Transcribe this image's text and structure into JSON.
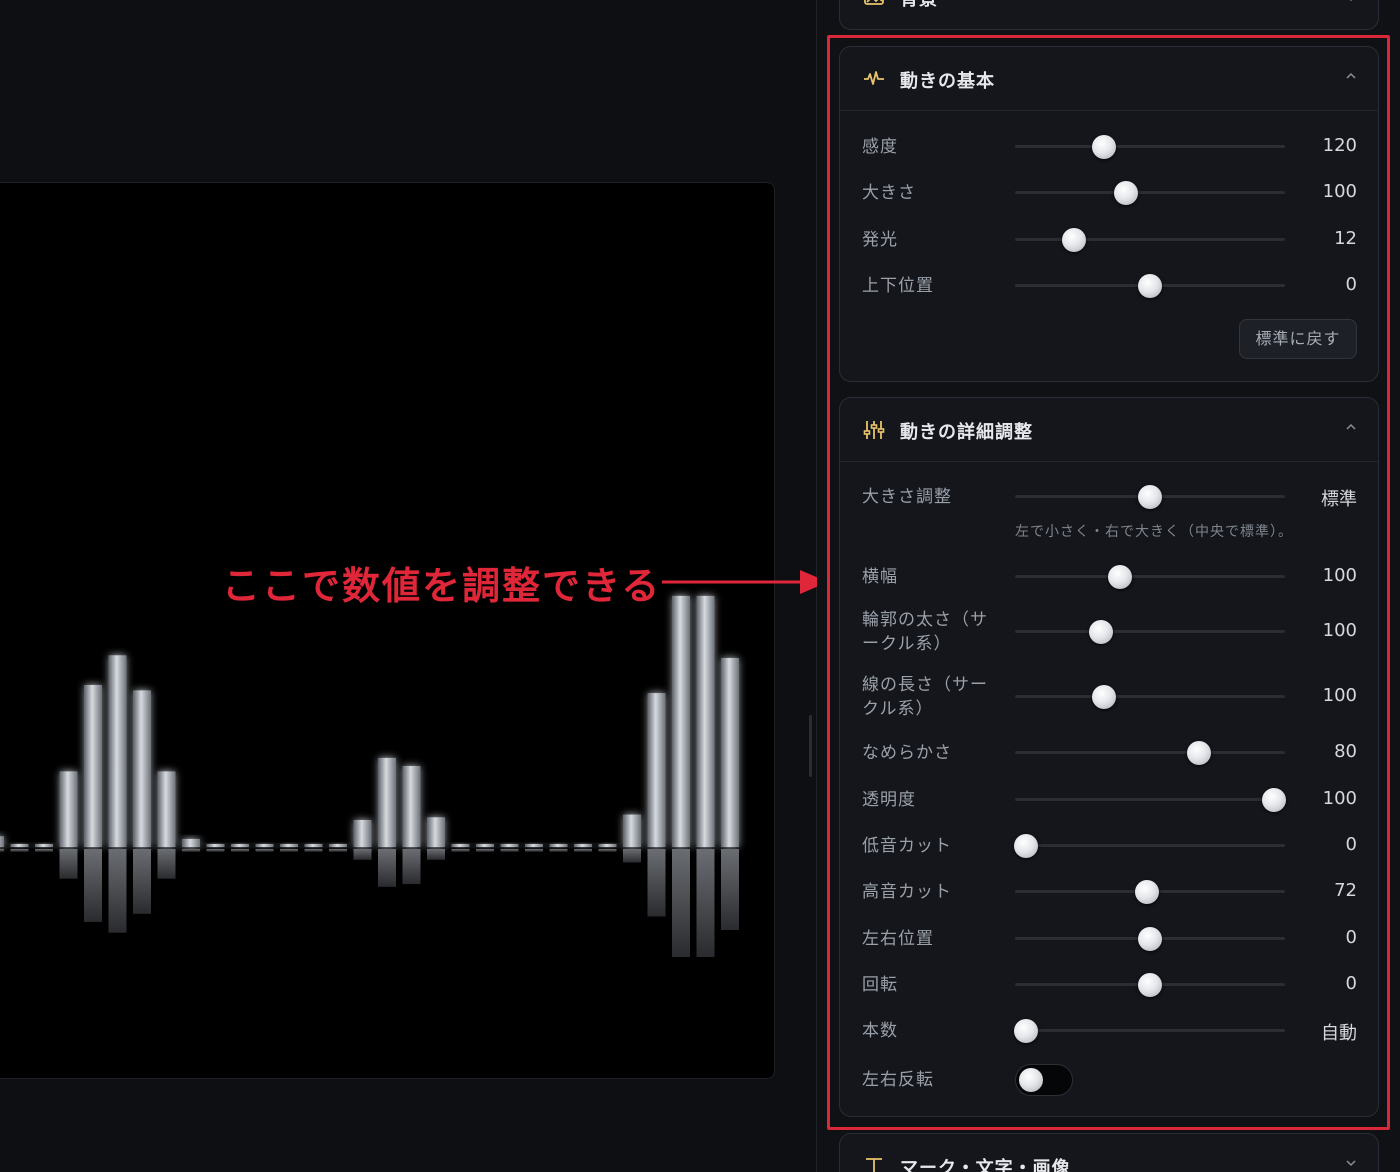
{
  "preview": {
    "bars_up": [
      0.04,
      0,
      0,
      0.28,
      0.6,
      0.71,
      0.58,
      0.28,
      0.03,
      0,
      0,
      0,
      0,
      0,
      0,
      0.1,
      0.33,
      0.3,
      0.11,
      0,
      0,
      0,
      0,
      0,
      0,
      0,
      0.12,
      0.57,
      0.93,
      0.93,
      0.7
    ],
    "bars_down": [
      0.01,
      0.01,
      0.01,
      0.11,
      0.27,
      0.31,
      0.24,
      0.11,
      0.01,
      0.01,
      0.01,
      0.01,
      0.01,
      0.01,
      0.01,
      0.04,
      0.14,
      0.13,
      0.04,
      0.01,
      0.01,
      0.01,
      0.01,
      0.01,
      0.01,
      0.01,
      0.05,
      0.25,
      0.4,
      0.4,
      0.3
    ]
  },
  "annotation": {
    "text": "ここで数値を調整できる",
    "color": "#e0273a"
  },
  "top_card": {
    "title": "背景",
    "icon": "image-icon"
  },
  "basic": {
    "title": "動きの基本",
    "icon": "activity-pulse-icon",
    "rows": [
      {
        "label": "感度",
        "value": "120",
        "pos": 0.33
      },
      {
        "label": "大きさ",
        "value": "100",
        "pos": 0.41
      },
      {
        "label": "発光",
        "value": "12",
        "pos": 0.22
      },
      {
        "label": "上下位置",
        "value": "0",
        "pos": 0.5
      }
    ],
    "reset_label": "標準に戻す"
  },
  "detail": {
    "title": "動きの詳細調整",
    "icon": "sliders-icon",
    "hint": "左で小さく・右で大きく（中央で標準）。",
    "rows": [
      {
        "label": "大きさ調整",
        "value": "標準",
        "pos": 0.5
      },
      {
        "label": "横幅",
        "value": "100",
        "pos": 0.39
      },
      {
        "label": "輪郭の太さ（サークル系）",
        "label_l1": "輪郭の太さ（サ",
        "label_l2": "ークル系）",
        "value": "100",
        "pos": 0.32
      },
      {
        "label": "線の長さ（サークル系）",
        "label_l1": "線の長さ（サー",
        "label_l2": "クル系）",
        "value": "100",
        "pos": 0.33
      },
      {
        "label": "なめらかさ",
        "value": "80",
        "pos": 0.68
      },
      {
        "label": "透明度",
        "value": "100",
        "pos": 0.96
      },
      {
        "label": "低音カット",
        "value": "0",
        "pos": 0.04
      },
      {
        "label": "高音カット",
        "value": "72",
        "pos": 0.49
      },
      {
        "label": "左右位置",
        "value": "0",
        "pos": 0.5
      },
      {
        "label": "回転",
        "value": "0",
        "pos": 0.5
      },
      {
        "label": "本数",
        "value": "自動",
        "pos": 0.04
      }
    ],
    "toggle": {
      "label": "左右反転",
      "on": false
    }
  },
  "bottom_card": {
    "title": "マーク・文字・画像",
    "icon": "text-type-icon"
  },
  "colors": {
    "accent_icon": "#e8c36a",
    "highlight": "#d8283a"
  }
}
